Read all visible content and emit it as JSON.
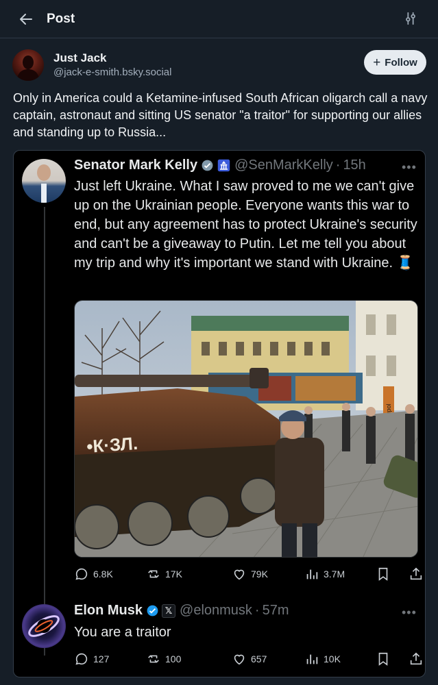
{
  "header": {
    "title": "Post"
  },
  "author": {
    "name": "Just Jack",
    "handle": "@jack-e-smith.bsky.social",
    "follow_label": "Follow"
  },
  "post": {
    "text": "Only in America could a Ketamine-infused South African oligarch call a navy captain, astronaut and sitting US senator \"a traitor\" for supporting our allies and standing up to Russia..."
  },
  "embed": {
    "tweet1": {
      "name": "Senator Mark Kelly",
      "handle": "@SenMarkKelly",
      "dot": "·",
      "time": "15h",
      "text": "Just left Ukraine. What I saw proved to me we can't give up on the Ukrainian people. Everyone wants this war to end, but any agreement has to protect Ukraine's security and can't be a giveaway to Putin. Let me tell you about my trip and why it's important we stand with Ukraine.",
      "emoji": "🧵",
      "photo_sign": "Mariupol",
      "stats": {
        "replies": "6.8K",
        "reposts": "17K",
        "likes": "79K",
        "views": "3.7M"
      }
    },
    "tweet2": {
      "name": "Elon Musk",
      "xbadge": "𝕏",
      "handle": "@elonmusk",
      "dot": "·",
      "time": "57m",
      "text": "You are a traitor",
      "stats": {
        "replies": "127",
        "reposts": "100",
        "likes": "657",
        "views": "10K"
      }
    }
  },
  "colors": {
    "background": "#161e27",
    "card": "#000000",
    "muted": "#71767b",
    "verified": "#1d9bf0"
  }
}
